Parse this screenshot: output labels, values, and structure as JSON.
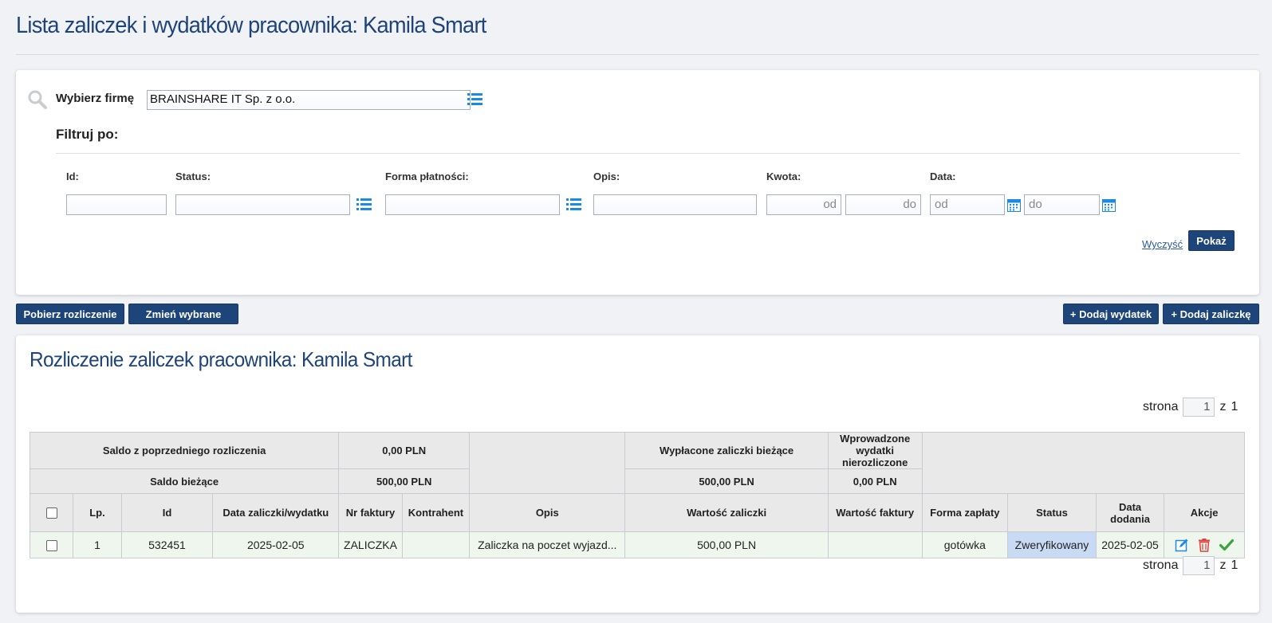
{
  "page_title": "Lista zaliczek i wydatków pracownika: Kamila Smart",
  "filter": {
    "firm_label": "Wybierz firmę",
    "firm_value": "BRAINSHARE IT Sp. z o.o.",
    "filter_heading": "Filtruj po:",
    "fields": {
      "id_label": "Id:",
      "status_label": "Status:",
      "payment_label": "Forma płatności:",
      "desc_label": "Opis:",
      "amount_label": "Kwota:",
      "date_label": "Data:",
      "amount_from_placeholder": "od",
      "amount_to_placeholder": "do",
      "date_from_placeholder": "od",
      "date_to_placeholder": "do"
    },
    "clear_label": "Wyczyść",
    "show_label": "Pokaż"
  },
  "toolbar": {
    "download_label": "Pobierz rozliczenie",
    "change_label": "Zmień wybrane",
    "add_expense_label": "+ Dodaj wydatek",
    "add_advance_label": "+ Dodaj zaliczkę"
  },
  "section_title": "Rozliczenie zaliczek pracownika: Kamila Smart",
  "pager": {
    "label": "strona",
    "page": "1",
    "of_label": "z",
    "total": "1"
  },
  "summary": {
    "prev_balance_label": "Saldo z poprzedniego rozliczenia",
    "prev_balance_value": "0,00 PLN",
    "current_balance_label": "Saldo bieżące",
    "current_balance_value": "500,00 PLN",
    "paid_advances_label": "Wypłacone zaliczki bieżące",
    "paid_advances_value": "500,00 PLN",
    "unsettled_expenses_label": "Wprowadzone wydatki nierozliczone",
    "unsettled_expenses_value": "0,00 PLN"
  },
  "columns": {
    "lp": "Lp.",
    "id": "Id",
    "date": "Data zaliczki/wydatku",
    "invoice_no": "Nr faktury",
    "contractor": "Kontrahent",
    "description": "Opis",
    "advance_value": "Wartość zaliczki",
    "invoice_value": "Wartość faktury",
    "payment_form": "Forma zapłaty",
    "status": "Status",
    "added_date": "Data dodania",
    "actions": "Akcje"
  },
  "rows": [
    {
      "lp": "1",
      "id": "532451",
      "date": "2025-02-05",
      "invoice_no": "ZALICZKA",
      "contractor": "",
      "description": "Zaliczka na poczet wyjazd...",
      "advance_value": "500,00 PLN",
      "invoice_value": "",
      "payment_form": "gotówka",
      "status": "Zweryfikowany",
      "added_date": "2025-02-05"
    }
  ],
  "colors": {
    "primary": "#1e4579",
    "title": "#1f4479",
    "row_bg": "#eef6ee",
    "status_bg": "#c9daf5"
  },
  "icons": [
    "search-icon",
    "list-icon",
    "calendar-icon",
    "edit-icon",
    "trash-icon",
    "check-icon"
  ]
}
